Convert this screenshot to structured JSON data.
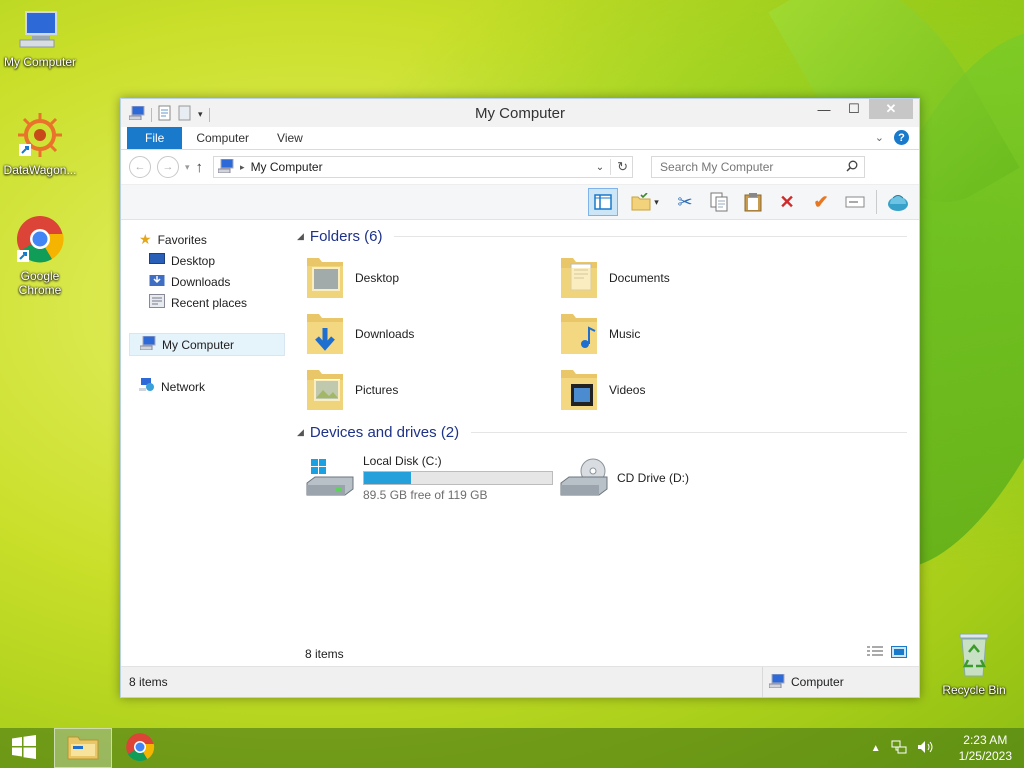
{
  "desktop": {
    "icons": [
      {
        "label": "My Computer"
      },
      {
        "label": "DataWagon..."
      },
      {
        "label": "Google Chrome"
      },
      {
        "label": "Recycle Bin"
      }
    ]
  },
  "window": {
    "title": "My Computer",
    "controls": {
      "minimize": "—",
      "maximize": "☐",
      "close": "✕"
    },
    "ribbon_tabs": [
      "File",
      "Computer",
      "View"
    ],
    "address": {
      "path": "My Computer"
    },
    "search": {
      "placeholder": "Search My Computer"
    },
    "nav": {
      "favorites": "Favorites",
      "favorites_items": [
        "Desktop",
        "Downloads",
        "Recent places"
      ],
      "my_computer": "My Computer",
      "network": "Network"
    },
    "folders_group": {
      "title": "Folders (6)",
      "items": [
        "Desktop",
        "Documents",
        "Downloads",
        "Music",
        "Pictures",
        "Videos"
      ]
    },
    "devices_group": {
      "title": "Devices and drives (2)",
      "local_disk": {
        "name": "Local Disk (C:)",
        "free_text": "89.5 GB free of 119 GB",
        "used_fraction": 0.25
      },
      "cd_drive": {
        "name": "CD Drive (D:)"
      }
    },
    "inner_status": "8 items",
    "status_bar": {
      "items": "8 items",
      "location": "Computer"
    }
  },
  "taskbar": {
    "clock": {
      "time": "2:23 AM",
      "date": "1/25/2023"
    }
  },
  "colors": {
    "accent": "#1979ca",
    "progress": "#26a0da",
    "group_title": "#1e3287"
  }
}
